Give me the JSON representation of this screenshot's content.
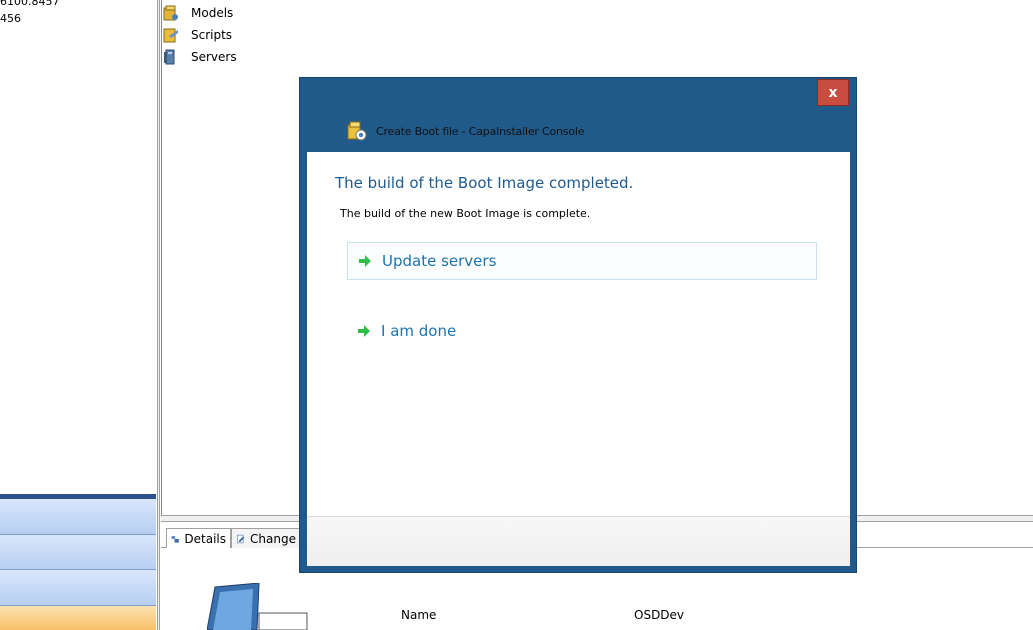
{
  "left_pane": {
    "lines": [
      "6100.8457",
      "456"
    ]
  },
  "tree": {
    "items": [
      {
        "label": "Models",
        "icon": "models-icon"
      },
      {
        "label": "Scripts",
        "icon": "scripts-icon"
      },
      {
        "label": "Servers",
        "icon": "servers-icon"
      }
    ]
  },
  "tabs": [
    {
      "label": "Details",
      "icon": "details-icon"
    },
    {
      "label": "Change",
      "icon": "change-icon"
    }
  ],
  "details": {
    "name_label": "Name",
    "name_value": "OSDDev"
  },
  "dialog": {
    "title": "Create Boot file - CapaInstaller Console",
    "close_label": "x",
    "heading": "The build of the Boot Image completed.",
    "message": "The build of the new Boot Image is complete.",
    "commands": [
      {
        "label": "Update servers",
        "selected": true
      },
      {
        "label": "I am done",
        "selected": false
      }
    ],
    "colors": {
      "frame": "#1f5a8a",
      "close": "#c94c40",
      "heading": "#1e5b8f",
      "link": "#1e73ab",
      "arrow": "#2fbf4a"
    }
  }
}
